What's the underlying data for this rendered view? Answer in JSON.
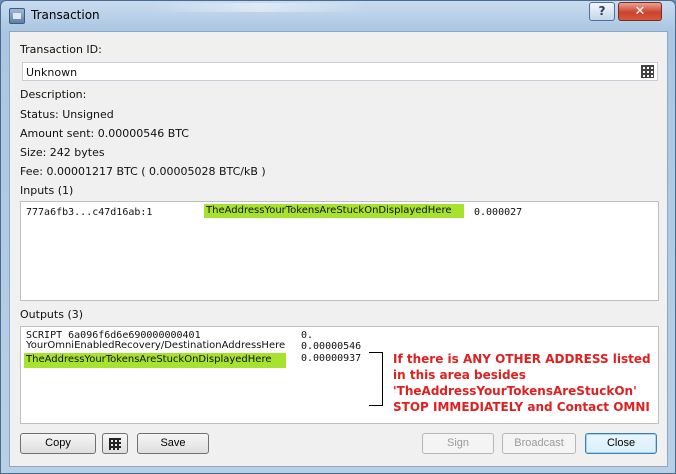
{
  "window": {
    "title": "Transaction",
    "help_label": "?",
    "close_label": "✕"
  },
  "txid": {
    "label": "Transaction ID:",
    "value": "Unknown"
  },
  "details": {
    "description": "Description:",
    "status": "Status: Unsigned",
    "amount": "Amount sent: 0.00000546 BTC",
    "size": "Size: 242 bytes",
    "fee": "Fee: 0.00001217 BTC  ( 0.00005028 BTC/kB )"
  },
  "inputs": {
    "label": "Inputs (1)",
    "rows": [
      {
        "txref": "777a6fb3...c47d16ab:1",
        "address": "TheAddressYourTokensAreStuckOnDisplayedHere",
        "amount": "0.000027"
      }
    ]
  },
  "outputs": {
    "label": "Outputs (3)",
    "rows": [
      {
        "address": "SCRIPT 6a096f6d6e690000000401",
        "amount": "0."
      },
      {
        "address": "YourOmniEnabledRecovery/DestinationAddressHere",
        "amount": "0.00000546"
      },
      {
        "address": "TheAddressYourTokensAreStuckOnDisplayedHere",
        "amount": "0.00000937"
      }
    ]
  },
  "warning": {
    "lines": [
      "If there is ANY OTHER ADDRESS listed",
      "in this area besides",
      "'TheAddressYourTokensAreStuckOn'",
      "STOP IMMEDIATELY and Contact OMNI"
    ]
  },
  "buttons": {
    "copy": "Copy",
    "save": "Save",
    "sign": "Sign",
    "broadcast": "Broadcast",
    "close": "Close"
  },
  "colors": {
    "highlight": "#a6e22e",
    "warning": "#e02020"
  },
  "icons": {
    "qr_field": "qr-code-icon",
    "qr_button": "qr-code-icon"
  }
}
